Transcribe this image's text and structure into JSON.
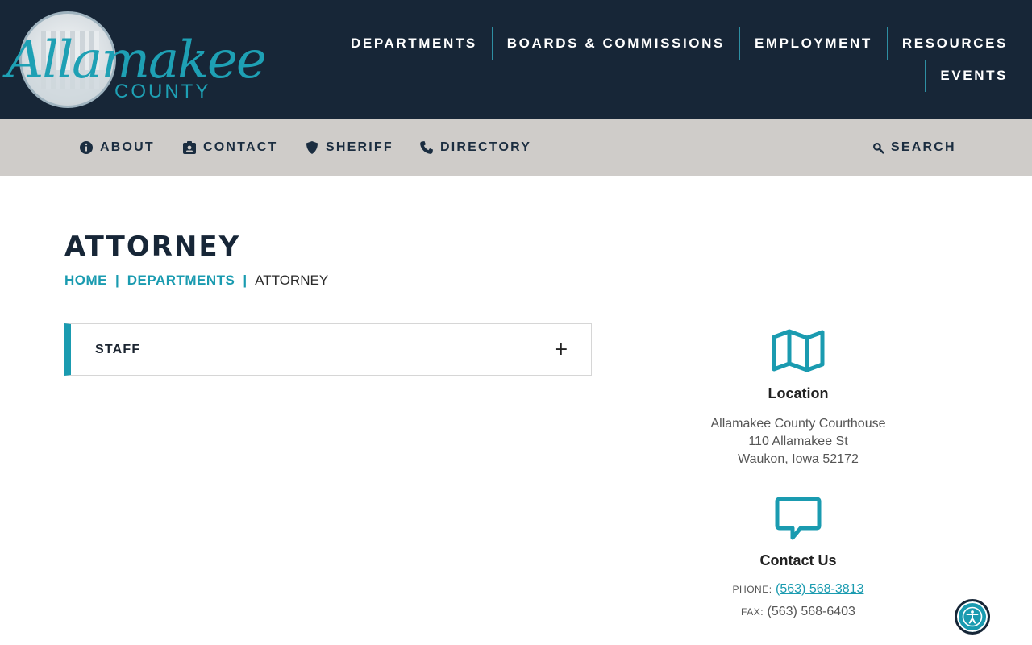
{
  "header": {
    "logo": {
      "script": "Allamakee",
      "sub": "COUNTY"
    },
    "nav_row1": [
      "DEPARTMENTS",
      "BOARDS & COMMISSIONS",
      "EMPLOYMENT",
      "RESOURCES"
    ],
    "nav_row2": [
      "EVENTS"
    ]
  },
  "subnav": {
    "about": {
      "label": "ABOUT",
      "icon": "info-circle-icon"
    },
    "contact": {
      "label": "CONTACT",
      "icon": "id-badge-icon"
    },
    "sheriff": {
      "label": "SHERIFF",
      "icon": "shield-icon"
    },
    "directory": {
      "label": "DIRECTORY",
      "icon": "phone-icon"
    },
    "search": {
      "label": "SEARCH",
      "icon": "search-icon"
    }
  },
  "page": {
    "title": "ATTORNEY",
    "breadcrumb": {
      "home": "HOME",
      "sep": "|",
      "departments": "DEPARTMENTS",
      "current": "ATTORNEY"
    }
  },
  "accordion": {
    "label": "STAFF",
    "toggle": "+"
  },
  "sidebar": {
    "location": {
      "heading": "Location",
      "line1": "Allamakee County Courthouse",
      "line2": "110 Allamakee St",
      "line3": "Waukon, Iowa 52172"
    },
    "contact": {
      "heading": "Contact Us",
      "phone_label": "PHONE:",
      "phone": "(563) 568-3813",
      "fax_label": "FAX:",
      "fax": "(563) 568-6403"
    }
  },
  "colors": {
    "header_bg": "#172637",
    "accent": "#1a9bb0",
    "subbar_bg": "#cfccc9"
  }
}
